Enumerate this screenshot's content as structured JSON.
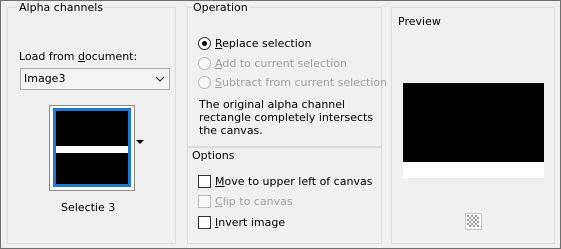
{
  "alpha_channels": {
    "title": "Alpha channels",
    "load_from_label": "Load from ",
    "load_from_underlined": "d",
    "load_from_rest": "ocument:",
    "document_value": "Image3",
    "channel_caption": "Selectie 3"
  },
  "operation": {
    "title": "Operation",
    "options": [
      {
        "underline": "R",
        "rest": "eplace selection",
        "selected": true,
        "enabled": true
      },
      {
        "underline": "A",
        "rest": "dd to current selection",
        "selected": false,
        "enabled": false
      },
      {
        "underline": "S",
        "rest": "ubtract from current selection",
        "selected": false,
        "enabled": false
      }
    ],
    "description": "The original alpha channel rectangle completely intersects the canvas."
  },
  "options": {
    "title": "Options",
    "checkboxes": [
      {
        "underline": "M",
        "rest": "ove to upper left of canvas",
        "checked": false,
        "enabled": true
      },
      {
        "underline": "C",
        "rest": "lip to canvas",
        "checked": false,
        "enabled": false
      },
      {
        "underline": "I",
        "rest": "nvert image",
        "checked": false,
        "enabled": true
      }
    ]
  },
  "preview": {
    "title": "Preview",
    "toggle_icon": "checkerboard-icon"
  }
}
